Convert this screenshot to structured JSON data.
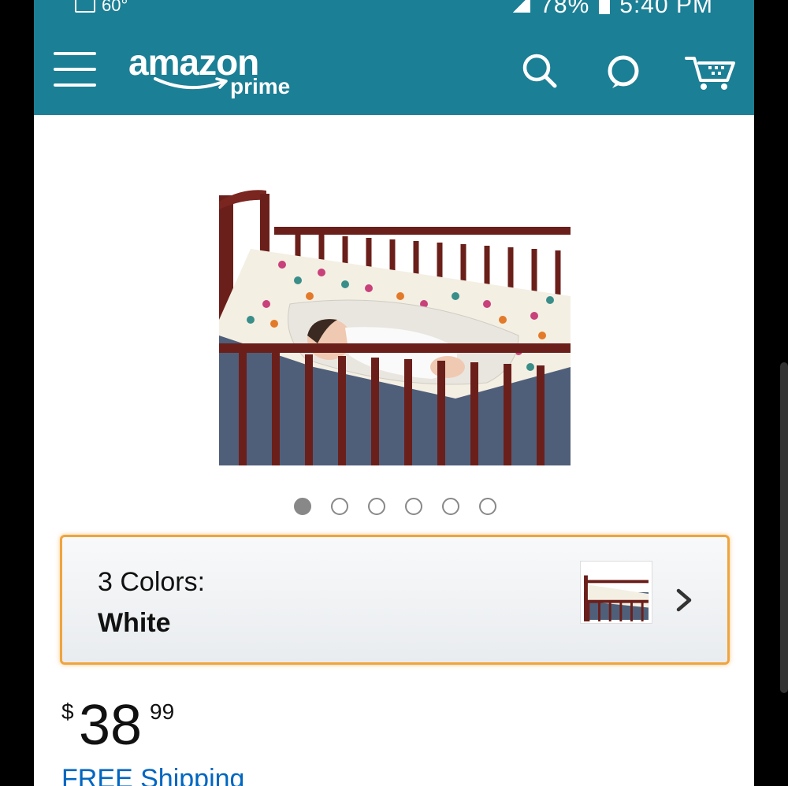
{
  "status_bar": {
    "temperature": "60°",
    "battery": "78%",
    "time": "5:40 PM"
  },
  "navbar": {
    "logo_text": "amazon",
    "logo_subtext": "prime",
    "icons": [
      "menu-icon",
      "search-icon",
      "alexa-icon",
      "cart-icon"
    ],
    "accent_color": "#1b7f95"
  },
  "product": {
    "image_icon": "baby-crib-hammock-image",
    "carousel": {
      "count": 6,
      "active_index": 0
    },
    "variant": {
      "label": "3 Colors:",
      "value": "White",
      "highlight_color": "#f0a43c"
    },
    "price": {
      "currency": "$",
      "whole": "38",
      "fraction": "99"
    },
    "shipping": "FREE Shipping"
  }
}
